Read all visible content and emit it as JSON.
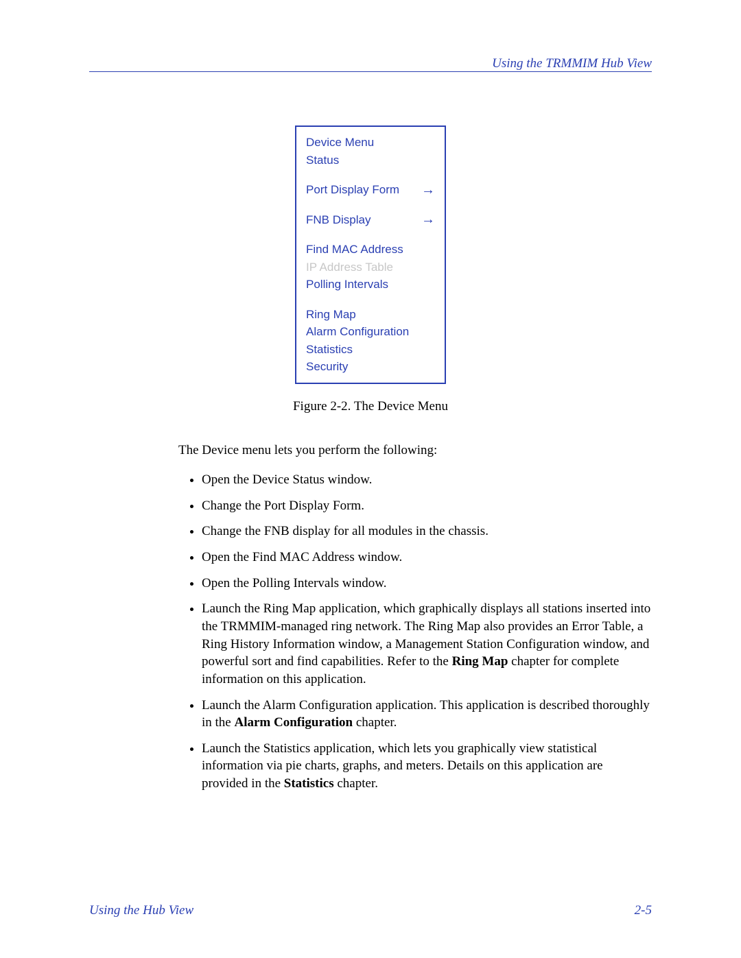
{
  "header": {
    "section_title": "Using the TRMMIM Hub View"
  },
  "menu": {
    "title": "Device Menu",
    "status": "Status",
    "port_display_form": "Port Display Form",
    "fnb_display": "FNB Display",
    "find_mac": "Find MAC Address",
    "ip_table": "IP Address Table",
    "polling": "Polling Intervals",
    "ring_map": "Ring Map",
    "alarm_config": "Alarm Configuration",
    "statistics": "Statistics",
    "security": "Security",
    "arrow": "→"
  },
  "figure_caption": "Figure 2-2. The Device Menu",
  "body": {
    "intro": "The Device menu lets you perform the following:",
    "b1": "Open the Device Status window.",
    "b2": "Change the Port Display Form.",
    "b3": "Change the FNB display for all modules in the chassis.",
    "b4": "Open the Find MAC Address window.",
    "b5": "Open the Polling Intervals window.",
    "b6a": "Launch the Ring Map application, which graphically displays all stations inserted into the TRMMIM-managed ring network. The Ring Map also provides an Error Table, a Ring History Information window, a Management Station Configuration window, and powerful sort and find capabilities. Refer to the ",
    "b6b": "Ring Map",
    "b6c": " chapter for complete information on this application.",
    "b7a": "Launch the Alarm Configuration application. This application is described thoroughly in the ",
    "b7b": "Alarm Configuration",
    "b7c": " chapter.",
    "b8a": "Launch the Statistics application, which lets you graphically view statistical information via pie charts, graphs, and meters. Details on this application are provided in the ",
    "b8b": "Statistics",
    "b8c": " chapter."
  },
  "footer": {
    "left": "Using the Hub View",
    "right": "2-5"
  }
}
